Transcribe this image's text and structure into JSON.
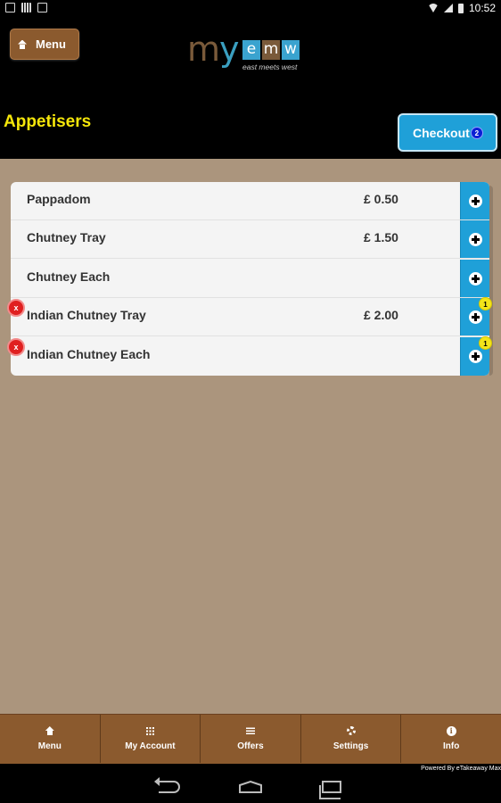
{
  "status_bar": {
    "time": "10:52"
  },
  "header": {
    "menu_label": "Menu",
    "logo": {
      "my": "my",
      "boxes": [
        "e",
        "m",
        "w"
      ],
      "tagline": "east meets west"
    },
    "title": "Appetisers",
    "checkout_label": "Checkout",
    "cart_count": "2",
    "colors": {
      "title": "#f5e60a",
      "checkout": "#1fa0d8",
      "menu": "#8b5a2e"
    }
  },
  "items": [
    {
      "name": "Pappadom",
      "price": "£ 0.50",
      "qty": "",
      "remove": ""
    },
    {
      "name": "Chutney Tray",
      "price": "£ 1.50",
      "qty": "",
      "remove": ""
    },
    {
      "name": "Chutney Each",
      "price": "",
      "qty": "",
      "remove": ""
    },
    {
      "name": "Indian Chutney Tray",
      "price": "£ 2.00",
      "qty": "1",
      "remove": "x"
    },
    {
      "name": "Indian Chutney Each",
      "price": "",
      "qty": "1",
      "remove": "x"
    }
  ],
  "tabs": [
    {
      "label": "Menu",
      "icon": "home-icon"
    },
    {
      "label": "My Account",
      "icon": "grid-icon"
    },
    {
      "label": "Offers",
      "icon": "list-icon"
    },
    {
      "label": "Settings",
      "icon": "gear-icon"
    },
    {
      "label": "Info",
      "icon": "info-icon",
      "glyph": "i"
    }
  ],
  "powered_by": "Powered By eTakeaway Max"
}
